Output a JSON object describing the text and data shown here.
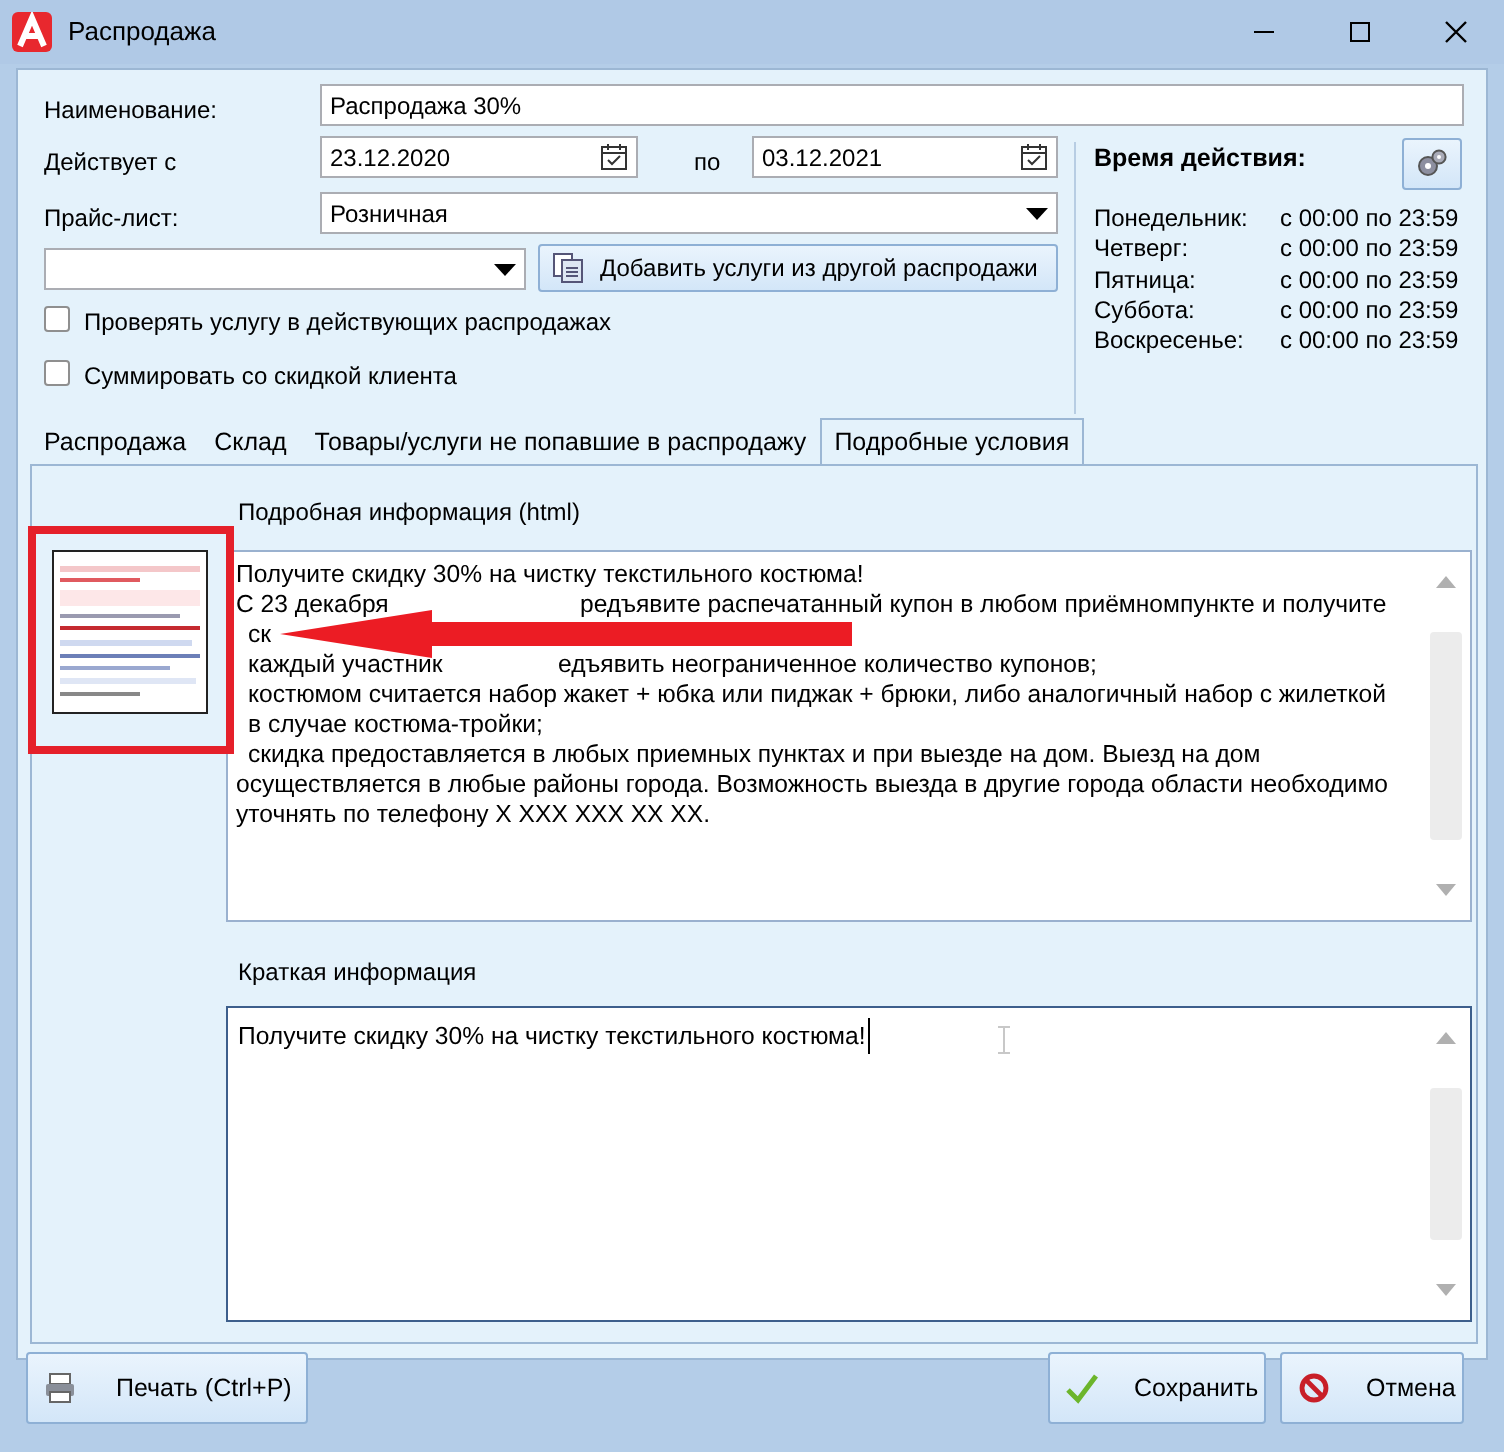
{
  "window": {
    "title": "Распродажа"
  },
  "form": {
    "name_label": "Наименование:",
    "name_value": "Распродажа 30%",
    "period_label": "Действует с",
    "date_from": "23.12.2020",
    "to_label": "по",
    "date_to": "03.12.2021",
    "price_list_label": "Прайс-лист:",
    "price_list_value": "Розничная",
    "add_services_button": "Добавить услуги из другой распродажи",
    "checkboxes": [
      {
        "label": "Проверять услугу в действующих распродажах",
        "checked": false
      },
      {
        "label": "Суммировать со скидкой клиента",
        "checked": false
      }
    ]
  },
  "schedule": {
    "title": "Время действия:",
    "days": [
      {
        "day": "Понедельник:",
        "time": "с 00:00 по 23:59"
      },
      {
        "day": "Четверг:",
        "time": "с 00:00 по 23:59"
      },
      {
        "day": "Пятница:",
        "time": "с 00:00 по 23:59"
      },
      {
        "day": "Суббота:",
        "time": "с 00:00 по 23:59"
      },
      {
        "day": "Воскресенье:",
        "time": "с 00:00 по 23:59"
      }
    ]
  },
  "tabs": [
    {
      "label": "Распродажа",
      "selected": false
    },
    {
      "label": "Склад",
      "selected": false
    },
    {
      "label": "Товары/услуги не попавшие в распродажу",
      "selected": false
    },
    {
      "label": "Подробные условия",
      "selected": true
    }
  ],
  "details": {
    "html_label": "Подробная информация (html)",
    "html_lines": [
      [
        "Получите скидку 30% на чистку текстильного костюма!"
      ],
      [
        "С 23 декабря",
        "редъявите распечатанный купон в любом приёмномпункте и получите"
      ],
      [
        "ск"
      ],
      [
        "каждый участник",
        "едъявить неограниченное количество купонов;"
      ],
      [
        "костюмом считается набор жакет + юбка или пиджак + брюки, либо аналогичный набор с жилеткой"
      ],
      [
        "в случае костюма-тройки;"
      ],
      [
        "скидка предоставляется в любых приемных пунктах и при выезде на дом. Выезд на дом"
      ],
      [
        "осуществляется в любые районы города. Возможность выезда в другие города области необходимо"
      ],
      [
        "уточнять по телефону X XXX XXX XX XX."
      ]
    ],
    "short_label": "Краткая информация",
    "short_text": "Получите скидку 30% на чистку текстильного костюма!"
  },
  "buttons": [
    {
      "kind": "print",
      "label": "Печать (Ctrl+P)"
    },
    {
      "kind": "save",
      "label": "Сохранить"
    },
    {
      "kind": "cancel",
      "label": "Отмена"
    }
  ]
}
